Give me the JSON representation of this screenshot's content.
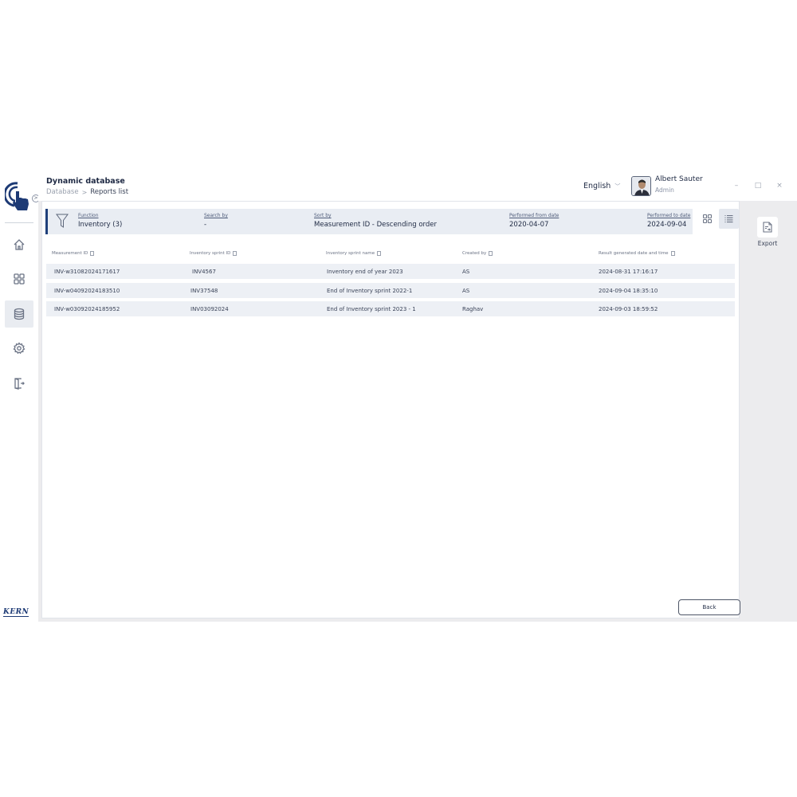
{
  "header": {
    "app_title": "Dynamic database",
    "breadcrumb": {
      "parent": "Database",
      "separator": ">",
      "current": "Reports list"
    },
    "language": "English",
    "user": {
      "name": "Albert Sauter",
      "role": "Admin"
    },
    "window_controls": {
      "minimize": "–",
      "maximize": "□",
      "close": "×"
    }
  },
  "sidebar": {
    "brand": "KERN",
    "expand_glyph": ">",
    "items": [
      {
        "icon": "home-icon",
        "active": false
      },
      {
        "icon": "grid-icon",
        "active": false
      },
      {
        "icon": "database-icon",
        "active": true
      },
      {
        "icon": "gear-icon",
        "active": false
      },
      {
        "icon": "logout-icon",
        "active": false
      }
    ]
  },
  "filters": {
    "function": {
      "label": "Function",
      "value": "Inventory (3)"
    },
    "search_by": {
      "label": "Search by",
      "value": "-"
    },
    "sort_by": {
      "label": "Sort by",
      "value": "Measurement ID - Descending order"
    },
    "from_date": {
      "label": "Performed from date",
      "value": "2020-04-07"
    },
    "to_date": {
      "label": "Performed to date",
      "value": "2024-09-04"
    }
  },
  "table": {
    "columns": [
      "Measurement ID",
      "Inventory sprint ID",
      "Inventory sprint name",
      "Created by",
      "Result generated date and time"
    ],
    "rows": [
      [
        "INV-w31082024171617",
        "INV4567",
        "Inventory end of year 2023",
        "AS",
        "2024-08-31 17:16:17"
      ],
      [
        "INV-w04092024183510",
        "INV37548",
        "End of Inventory sprint 2022-1",
        "AS",
        "2024-09-04 18:35:10"
      ],
      [
        "INV-w03092024185952",
        "INV03092024",
        "End of Inventory sprint 2023 - 1",
        "Raghav",
        "2024-09-03 18:59:52"
      ]
    ]
  },
  "actions": {
    "back": "Back",
    "export": "Export"
  },
  "colors": {
    "accent": "#1f3f7a",
    "row_bg": "#edf0f5",
    "filter_bg": "#e9edf3"
  }
}
